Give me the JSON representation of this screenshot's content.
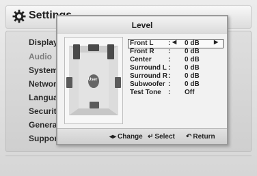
{
  "header": {
    "title": "Settings",
    "icon": "gear-icon"
  },
  "sidebar": {
    "items": [
      {
        "label": "Display"
      },
      {
        "label": "Audio"
      },
      {
        "label": "System"
      },
      {
        "label": "Network"
      },
      {
        "label": "Language"
      },
      {
        "label": "Security"
      },
      {
        "label": "General"
      },
      {
        "label": "Support"
      }
    ]
  },
  "dialog": {
    "title": "Level",
    "user_label": "User",
    "rows": [
      {
        "label": "Front L",
        "value": "0 dB"
      },
      {
        "label": "Front R",
        "value": "0 dB"
      },
      {
        "label": "Center",
        "value": "0 dB"
      },
      {
        "label": "Surround L",
        "value": "0 dB"
      },
      {
        "label": "Surround R",
        "value": "0 dB"
      },
      {
        "label": "Subwoofer",
        "value": "0 dB"
      },
      {
        "label": "Test Tone",
        "value": "Off"
      }
    ],
    "footer": {
      "change_label": "Change",
      "select_label": "Select",
      "return_label": "Return"
    }
  }
}
